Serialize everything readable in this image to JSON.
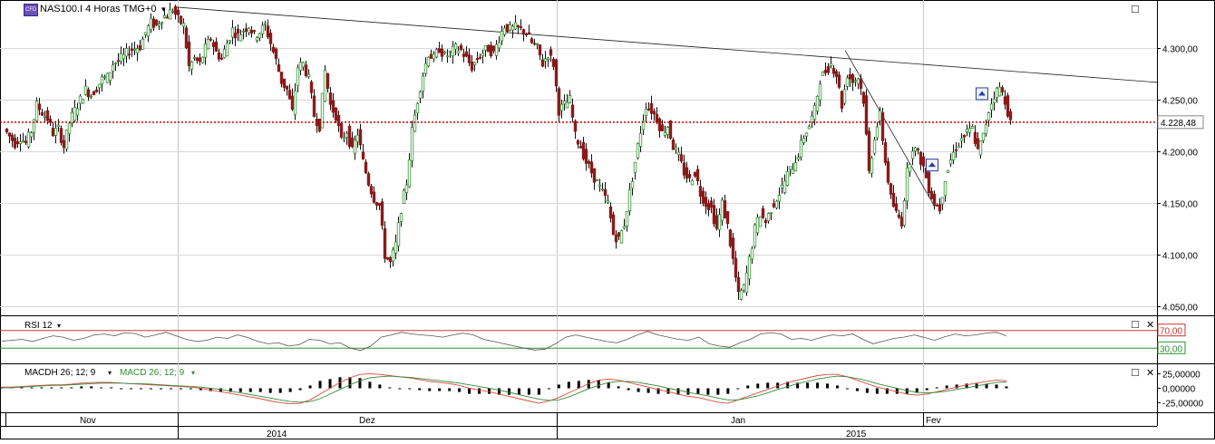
{
  "header": {
    "symbol_label": "NAS100.I 4 Horas TMG+0",
    "cfd_badge": "CFD",
    "dropdown_arrow": "▾"
  },
  "panels": {
    "rsi": {
      "label": "RSI 12",
      "levels": [
        70,
        30
      ],
      "level_labels": [
        "70,00",
        "30,00"
      ],
      "ylim": [
        0,
        100
      ]
    },
    "macd": {
      "histogram_label": "MACDH 26; 12; 9",
      "line_label": "MACD 26; 12; 9",
      "tick_labels": [
        "25,00000",
        "0,00000",
        "-25,00000"
      ],
      "ticks": [
        25,
        0,
        -25
      ],
      "ylim": [
        -40,
        40
      ]
    }
  },
  "window_controls": {
    "maximize_symbol": "□",
    "close_symbol": "✕"
  },
  "chart_data": {
    "type": "candlestick",
    "symbol": "NAS100.I",
    "timeframe": "4 Horas",
    "ylim": [
      4045,
      4345
    ],
    "y_ticks": [
      4050,
      4100,
      4150,
      4200,
      4250,
      4300
    ],
    "y_tick_labels": [
      "4.050,00",
      "4.100,00",
      "4.150,00",
      "4.200,00",
      "4.250,00",
      "4.300,00"
    ],
    "current_price": 4228.48,
    "current_price_label": "4.228,48",
    "colors": {
      "up": "#2f8f2f",
      "down": "#8b1a1a",
      "price_line": "#cc0000",
      "rsi": "#555555",
      "macd_line": "#d94a3a",
      "signal_line": "#3a8a3a"
    },
    "x_month_labels": [
      {
        "label": "Nov",
        "index": 0
      },
      {
        "label": "Dez",
        "index": 1
      },
      {
        "label": "Jan",
        "index": 2
      },
      {
        "label": "Fev",
        "index": 3
      }
    ],
    "x_year_labels": [
      {
        "label": "2014",
        "index": 0
      },
      {
        "label": "2015",
        "index": 1
      }
    ],
    "price_path": [
      [
        0,
        4222
      ],
      [
        6,
        4215
      ],
      [
        12,
        4208
      ],
      [
        18,
        4214
      ],
      [
        24,
        4208
      ],
      [
        30,
        4220
      ],
      [
        36,
        4245
      ],
      [
        42,
        4238
      ],
      [
        48,
        4232
      ],
      [
        54,
        4218
      ],
      [
        60,
        4222
      ],
      [
        66,
        4205
      ],
      [
        72,
        4228
      ],
      [
        78,
        4240
      ],
      [
        84,
        4250
      ],
      [
        90,
        4260
      ],
      [
        96,
        4255
      ],
      [
        102,
        4262
      ],
      [
        108,
        4270
      ],
      [
        114,
        4272
      ],
      [
        120,
        4285
      ],
      [
        126,
        4288
      ],
      [
        132,
        4292
      ],
      [
        138,
        4298
      ],
      [
        144,
        4300
      ],
      [
        150,
        4302
      ],
      [
        156,
        4315
      ],
      [
        162,
        4325
      ],
      [
        168,
        4322
      ],
      [
        174,
        4330
      ],
      [
        180,
        4332
      ],
      [
        186,
        4338
      ],
      [
        192,
        4328
      ],
      [
        198,
        4322
      ],
      [
        204,
        4282
      ],
      [
        210,
        4290
      ],
      [
        216,
        4285
      ],
      [
        222,
        4300
      ],
      [
        228,
        4310
      ],
      [
        234,
        4296
      ],
      [
        240,
        4290
      ],
      [
        246,
        4305
      ],
      [
        252,
        4318
      ],
      [
        258,
        4312
      ],
      [
        264,
        4318
      ],
      [
        270,
        4322
      ],
      [
        276,
        4312
      ],
      [
        282,
        4316
      ],
      [
        288,
        4322
      ],
      [
        294,
        4305
      ],
      [
        300,
        4288
      ],
      [
        306,
        4268
      ],
      [
        312,
        4260
      ],
      [
        318,
        4238
      ],
      [
        324,
        4282
      ],
      [
        330,
        4285
      ],
      [
        336,
        4270
      ],
      [
        342,
        4235
      ],
      [
        348,
        4225
      ],
      [
        354,
        4278
      ],
      [
        360,
        4245
      ],
      [
        366,
        4235
      ],
      [
        372,
        4210
      ],
      [
        378,
        4220
      ],
      [
        384,
        4200
      ],
      [
        390,
        4218
      ],
      [
        396,
        4190
      ],
      [
        402,
        4170
      ],
      [
        408,
        4155
      ],
      [
        414,
        4148
      ],
      [
        420,
        4100
      ],
      [
        426,
        4092
      ],
      [
        432,
        4110
      ],
      [
        438,
        4145
      ],
      [
        444,
        4170
      ],
      [
        450,
        4220
      ],
      [
        456,
        4250
      ],
      [
        462,
        4275
      ],
      [
        468,
        4295
      ],
      [
        474,
        4290
      ],
      [
        480,
        4300
      ],
      [
        486,
        4292
      ],
      [
        492,
        4295
      ],
      [
        498,
        4300
      ],
      [
        504,
        4298
      ],
      [
        510,
        4290
      ],
      [
        516,
        4282
      ],
      [
        522,
        4290
      ],
      [
        528,
        4296
      ],
      [
        534,
        4300
      ],
      [
        540,
        4295
      ],
      [
        546,
        4310
      ],
      [
        552,
        4322
      ],
      [
        558,
        4318
      ],
      [
        564,
        4320
      ],
      [
        570,
        4318
      ],
      [
        576,
        4315
      ],
      [
        582,
        4305
      ],
      [
        588,
        4300
      ],
      [
        594,
        4285
      ],
      [
        600,
        4295
      ],
      [
        606,
        4285
      ],
      [
        612,
        4240
      ],
      [
        618,
        4245
      ],
      [
        624,
        4250
      ],
      [
        630,
        4215
      ],
      [
        636,
        4205
      ],
      [
        642,
        4190
      ],
      [
        648,
        4180
      ],
      [
        654,
        4170
      ],
      [
        660,
        4160
      ],
      [
        666,
        4150
      ],
      [
        672,
        4120
      ],
      [
        678,
        4115
      ],
      [
        684,
        4130
      ],
      [
        690,
        4160
      ],
      [
        696,
        4190
      ],
      [
        702,
        4220
      ],
      [
        708,
        4245
      ],
      [
        714,
        4240
      ],
      [
        720,
        4232
      ],
      [
        726,
        4218
      ],
      [
        732,
        4225
      ],
      [
        738,
        4205
      ],
      [
        744,
        4195
      ],
      [
        750,
        4180
      ],
      [
        756,
        4172
      ],
      [
        762,
        4180
      ],
      [
        768,
        4160
      ],
      [
        774,
        4150
      ],
      [
        780,
        4145
      ],
      [
        786,
        4125
      ],
      [
        792,
        4150
      ],
      [
        798,
        4128
      ],
      [
        804,
        4095
      ],
      [
        810,
        4060
      ],
      [
        816,
        4068
      ],
      [
        822,
        4095
      ],
      [
        828,
        4125
      ],
      [
        834,
        4140
      ],
      [
        840,
        4132
      ],
      [
        846,
        4145
      ],
      [
        852,
        4155
      ],
      [
        858,
        4165
      ],
      [
        864,
        4178
      ],
      [
        870,
        4186
      ],
      [
        876,
        4198
      ],
      [
        882,
        4215
      ],
      [
        888,
        4225
      ],
      [
        894,
        4240
      ],
      [
        900,
        4270
      ],
      [
        906,
        4278
      ],
      [
        912,
        4285
      ],
      [
        918,
        4275
      ],
      [
        924,
        4245
      ],
      [
        930,
        4275
      ],
      [
        936,
        4268
      ],
      [
        942,
        4272
      ],
      [
        948,
        4250
      ],
      [
        954,
        4180
      ],
      [
        960,
        4215
      ],
      [
        966,
        4235
      ],
      [
        972,
        4190
      ],
      [
        978,
        4155
      ],
      [
        984,
        4140
      ],
      [
        990,
        4132
      ],
      [
        996,
        4180
      ],
      [
        1002,
        4205
      ],
      [
        1008,
        4198
      ],
      [
        1014,
        4185
      ],
      [
        1020,
        4165
      ],
      [
        1026,
        4150
      ],
      [
        1032,
        4145
      ],
      [
        1038,
        4175
      ],
      [
        1044,
        4192
      ],
      [
        1050,
        4205
      ],
      [
        1056,
        4212
      ],
      [
        1062,
        4218
      ],
      [
        1068,
        4222
      ],
      [
        1074,
        4200
      ],
      [
        1080,
        4215
      ],
      [
        1086,
        4240
      ],
      [
        1092,
        4255
      ],
      [
        1098,
        4262
      ],
      [
        1104,
        4250
      ],
      [
        1110,
        4228
      ]
    ],
    "trendlines": [
      {
        "from": [
          186,
          4340
        ],
        "to": [
          1276,
          4267
        ]
      },
      {
        "from": [
          926,
          4298
        ],
        "to": [
          1024,
          4148
        ]
      }
    ],
    "markers": [
      {
        "x": 1022,
        "y": 4187,
        "kind": "signal"
      },
      {
        "x": 1077,
        "y": 4256,
        "kind": "signal"
      }
    ],
    "rsi_values": [
      46,
      48,
      50,
      45,
      52,
      58,
      55,
      48,
      52,
      60,
      62,
      58,
      65,
      63,
      55,
      60,
      66,
      58,
      50,
      45,
      48,
      55,
      52,
      60,
      54,
      45,
      40,
      42,
      35,
      38,
      50,
      48,
      40,
      42,
      30,
      25,
      35,
      55,
      60,
      66,
      62,
      60,
      58,
      55,
      60,
      64,
      60,
      50,
      45,
      40,
      35,
      30,
      26,
      28,
      40,
      55,
      60,
      55,
      50,
      45,
      42,
      50,
      60,
      68,
      60,
      55,
      50,
      48,
      55,
      40,
      35,
      32,
      42,
      50,
      62,
      65,
      62,
      50,
      52,
      48,
      55,
      60,
      58,
      62,
      50,
      40,
      46,
      52,
      55,
      60,
      54,
      48,
      56,
      62,
      58,
      60,
      64,
      66,
      58
    ],
    "macd_values": [
      2,
      2,
      3,
      4,
      5,
      6,
      6,
      7,
      9,
      10,
      10,
      10,
      9,
      8,
      7,
      6,
      5,
      4,
      3,
      2,
      0,
      -3,
      -6,
      -9,
      -12,
      -15,
      -18,
      -22,
      -25,
      -27,
      -26,
      -20,
      -10,
      0,
      10,
      18,
      24,
      25,
      24,
      22,
      20,
      18,
      15,
      12,
      10,
      8,
      5,
      0,
      -3,
      -6,
      -10,
      -14,
      -18,
      -22,
      -26,
      -22,
      -16,
      -8,
      0,
      8,
      14,
      16,
      14,
      10,
      6,
      2,
      -2,
      -6,
      -10,
      -14,
      -16,
      -20,
      -24,
      -26,
      -20,
      -14,
      -8,
      -2,
      4,
      10,
      14,
      18,
      22,
      24,
      24,
      20,
      14,
      8,
      2,
      -2,
      -6,
      -10,
      -12,
      -10,
      -6,
      -2,
      2,
      6,
      9,
      12,
      14,
      13
    ],
    "signal_values": [
      1,
      1,
      2,
      3,
      4,
      5,
      5,
      6,
      7,
      8,
      9,
      9,
      9,
      8,
      8,
      7,
      6,
      5,
      4,
      3,
      2,
      0,
      -2,
      -5,
      -8,
      -11,
      -14,
      -17,
      -20,
      -23,
      -24,
      -23,
      -18,
      -10,
      -2,
      6,
      13,
      18,
      20,
      21,
      20,
      19,
      17,
      15,
      13,
      11,
      9,
      6,
      3,
      0,
      -3,
      -7,
      -11,
      -15,
      -19,
      -21,
      -20,
      -15,
      -8,
      -1,
      5,
      10,
      12,
      12,
      10,
      7,
      4,
      0,
      -3,
      -7,
      -10,
      -13,
      -17,
      -20,
      -20,
      -17,
      -13,
      -8,
      -2,
      3,
      8,
      12,
      16,
      19,
      21,
      20,
      17,
      13,
      8,
      4,
      0,
      -4,
      -7,
      -8,
      -7,
      -5,
      -2,
      1,
      4,
      7,
      10,
      11
    ]
  }
}
